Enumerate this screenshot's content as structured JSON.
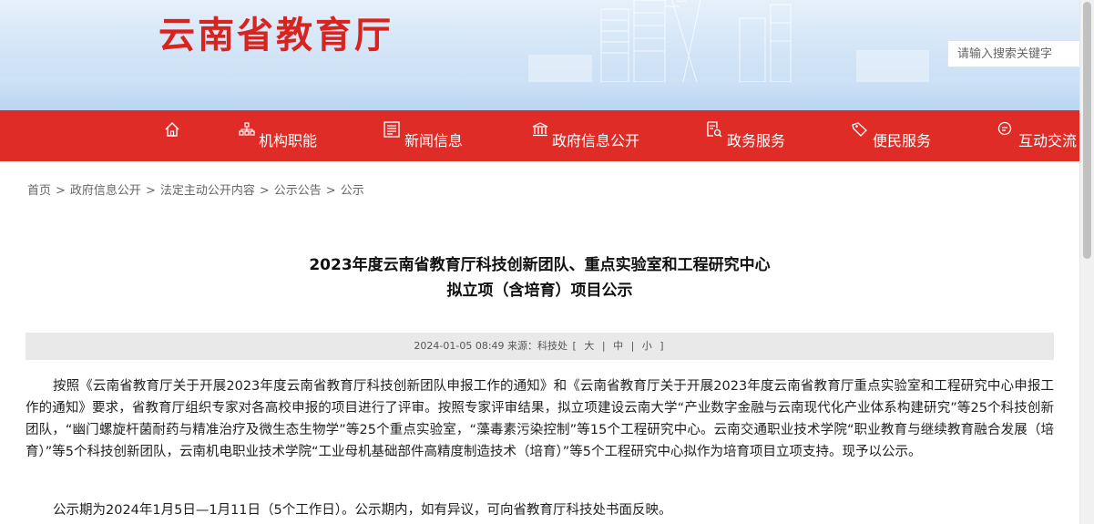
{
  "site": {
    "title": "云南省教育厅",
    "search_placeholder": "请输入搜索关键字",
    "brand_color": "#d9231f",
    "nav_color": "#e02c27"
  },
  "nav": {
    "home_icon": "home-icon",
    "items": [
      {
        "label": "机构职能",
        "icon": "org-chart-icon"
      },
      {
        "label": "新闻信息",
        "icon": "newspaper-icon"
      },
      {
        "label": "政府信息公开",
        "icon": "government-building-icon"
      },
      {
        "label": "政务服务",
        "icon": "document-search-icon"
      },
      {
        "label": "便民服务",
        "icon": "tag-icon"
      },
      {
        "label": "互动交流",
        "icon": "chat-bubble-icon"
      }
    ]
  },
  "breadcrumb": {
    "items": [
      "首页",
      "政府信息公开",
      "法定主动公开内容",
      "公示公告",
      "公示"
    ],
    "separator": ">"
  },
  "article": {
    "title_line1": "2023年度云南省教育厅科技创新团队、重点实验室和工程研究中心",
    "title_line2": "拟立项（含培育）项目公示",
    "meta": {
      "date": "2024-01-05 08:49",
      "source_label": "来源：",
      "source": "科技处",
      "bracket_open": "[",
      "bracket_close": "]",
      "divider": "|",
      "font_sizes": [
        "大",
        "中",
        "小"
      ]
    },
    "paragraphs": [
      "按照《云南省教育厅关于开展2023年度云南省教育厅科技创新团队申报工作的通知》和《云南省教育厅关于开展2023年度云南省教育厅重点实验室和工程研究中心申报工作的通知》要求，省教育厅组织专家对各高校申报的项目进行了评审。按照专家评审结果，拟立项建设云南大学“产业数字金融与云南现代化产业体系构建研究”等25个科技创新团队，“幽门螺旋杆菌耐药与精准治疗及微生态生物学”等25个重点实验室，“藻毒素污染控制”等15个工程研究中心。云南交通职业技术学院“职业教育与继续教育融合发展（培育）”等5个科技创新团队，云南机电职业技术学院“工业母机基础部件高精度制造技术（培育）”等5个工程研究中心拟作为培育项目立项支持。现予以公示。",
      "公示期为2024年1月5日—1月11日（5个工作日）。公示期内，如有异议，可向省教育厅科技处书面反映。"
    ]
  }
}
